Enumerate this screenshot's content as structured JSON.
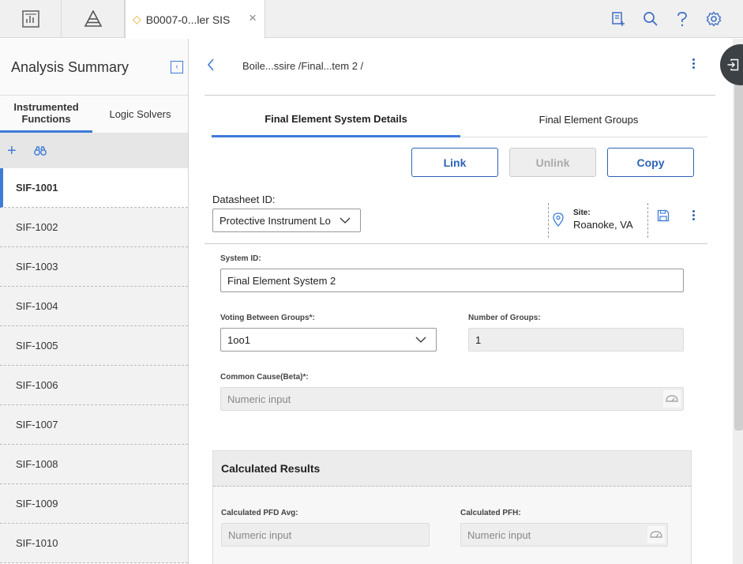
{
  "topbar": {
    "tab_title": "B0007-0...ler SIS",
    "tab_close": "×"
  },
  "left_panel": {
    "title": "Analysis Summary",
    "tabs": [
      {
        "label": "Instrumented Functions",
        "active": true
      },
      {
        "label": "Logic Solvers",
        "active": false
      }
    ],
    "toolbar": {
      "add": "+"
    },
    "items": [
      {
        "label": "SIF-1001",
        "selected": true
      },
      {
        "label": "SIF-1002"
      },
      {
        "label": "SIF-1003"
      },
      {
        "label": "SIF-1004"
      },
      {
        "label": "SIF-1005"
      },
      {
        "label": "SIF-1006"
      },
      {
        "label": "SIF-1007"
      },
      {
        "label": "SIF-1008"
      },
      {
        "label": "SIF-1009"
      },
      {
        "label": "SIF-1010"
      }
    ]
  },
  "main": {
    "breadcrumb": "Boile...ssire /Final...tem 2 /",
    "subtabs": [
      {
        "label": "Final Element System Details",
        "active": true
      },
      {
        "label": "Final Element Groups",
        "active": false
      }
    ],
    "buttons": {
      "link": "Link",
      "unlink": "Unlink",
      "copy": "Copy"
    },
    "datasheet": {
      "label": "Datasheet ID:",
      "value": "Protective Instrument Lo"
    },
    "site": {
      "label": "Site:",
      "value": "Roanoke, VA"
    },
    "fields": {
      "system_id": {
        "label": "System ID:",
        "value": "Final Element System 2"
      },
      "voting": {
        "label": "Voting Between Groups*:",
        "value": "1oo1"
      },
      "num_groups": {
        "label": "Number of Groups:",
        "value": "1"
      },
      "common_cause": {
        "label": "Common Cause(Beta)*:",
        "placeholder": "Numeric input"
      }
    },
    "calculated": {
      "title": "Calculated Results",
      "pfd": {
        "label": "Calculated PFD Avg:",
        "placeholder": "Numeric input"
      },
      "pfh": {
        "label": "Calculated PFH:",
        "placeholder": "Numeric input"
      }
    }
  },
  "colors": {
    "accent": "#3f7bd9",
    "button": "#2d63b8",
    "tab_icon": "#e5a823"
  }
}
